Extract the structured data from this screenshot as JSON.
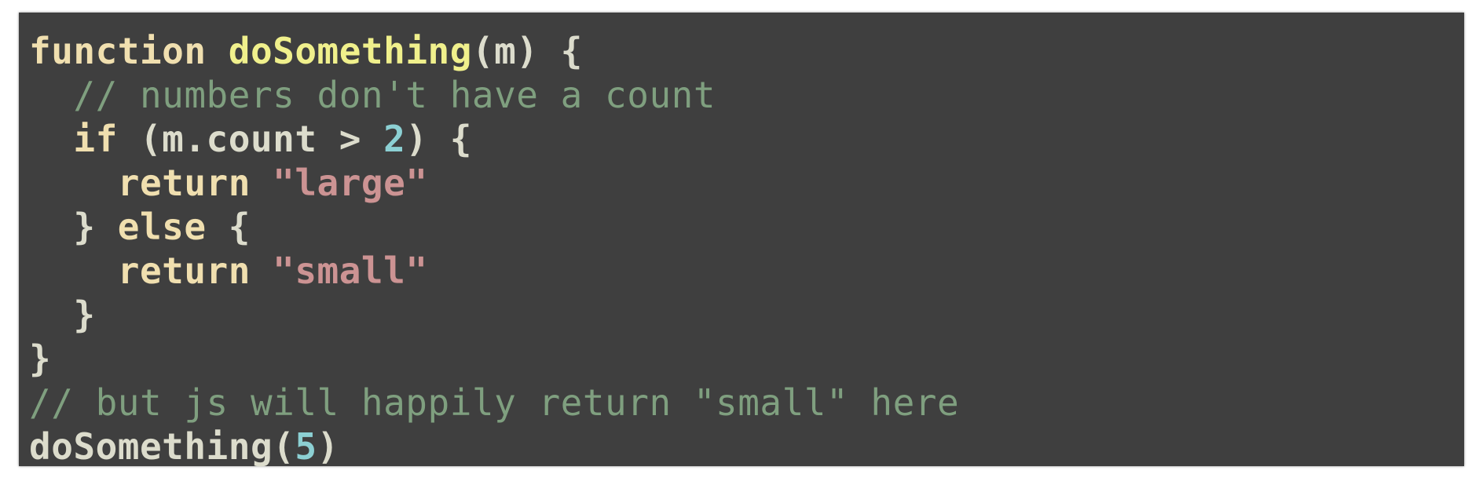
{
  "colors": {
    "background": "#3f3f3f",
    "plain": "#dcdccc",
    "keyword": "#f0dfaf",
    "function_name": "#f0f08c",
    "number": "#8cd0d3",
    "string": "#cc9393",
    "comment": "#7f9f7f"
  },
  "code": {
    "lines": [
      [
        {
          "t": "kw",
          "v": "function"
        },
        {
          "t": "pl",
          "v": " "
        },
        {
          "t": "fn",
          "v": "doSomething"
        },
        {
          "t": "pl",
          "v": "(m) {"
        }
      ],
      [
        {
          "t": "pl",
          "v": "  "
        },
        {
          "t": "cm",
          "v": "// numbers don't have a count"
        }
      ],
      [
        {
          "t": "pl",
          "v": "  "
        },
        {
          "t": "kw",
          "v": "if"
        },
        {
          "t": "pl",
          "v": " (m.count > "
        },
        {
          "t": "num",
          "v": "2"
        },
        {
          "t": "pl",
          "v": ") {"
        }
      ],
      [
        {
          "t": "pl",
          "v": "    "
        },
        {
          "t": "kw",
          "v": "return"
        },
        {
          "t": "pl",
          "v": " "
        },
        {
          "t": "str",
          "v": "\"large\""
        }
      ],
      [
        {
          "t": "pl",
          "v": "  } "
        },
        {
          "t": "kw",
          "v": "else"
        },
        {
          "t": "pl",
          "v": " {"
        }
      ],
      [
        {
          "t": "pl",
          "v": "    "
        },
        {
          "t": "kw",
          "v": "return"
        },
        {
          "t": "pl",
          "v": " "
        },
        {
          "t": "str",
          "v": "\"small\""
        }
      ],
      [
        {
          "t": "pl",
          "v": "  }"
        }
      ],
      [
        {
          "t": "pl",
          "v": "}"
        }
      ],
      [
        {
          "t": "cm",
          "v": "// but js will happily return \"small\" here"
        }
      ],
      [
        {
          "t": "pl",
          "v": "doSomething("
        },
        {
          "t": "num",
          "v": "5"
        },
        {
          "t": "pl",
          "v": ")"
        }
      ]
    ]
  }
}
